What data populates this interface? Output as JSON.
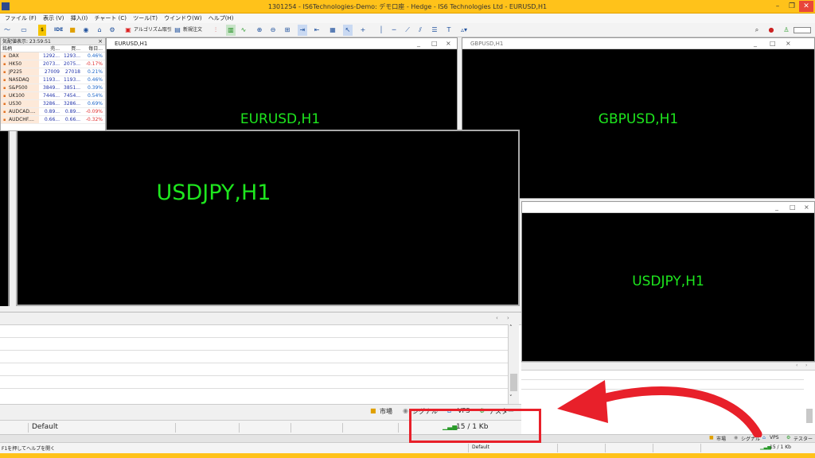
{
  "window": {
    "title": "1301254 - IS6Technologies-Demo: デモ口座 - Hedge - IS6 Technologies Ltd - EURUSD,H1",
    "minimize": "–",
    "maximize": "❐",
    "close": "✕"
  },
  "menu": [
    "ファイル (F)",
    "表示 (V)",
    "挿入(I)",
    "チャート (C)",
    "ツール(T)",
    "ウインドウ(W)",
    "ヘルプ(H)"
  ],
  "toolbar": {
    "algo_label": "アルゴリズム取引",
    "new_order_label": "新規注文",
    "ide_label": "IDE"
  },
  "market_watch": {
    "header": "気配値表示: 23:59:51",
    "columns": [
      "銘柄",
      "売...",
      "買...",
      "毎日..."
    ],
    "rows": [
      {
        "symbol": "DAX",
        "bid": "1292...",
        "ask": "1293...",
        "change": "0.46%"
      },
      {
        "symbol": "HK50",
        "bid": "2073...",
        "ask": "2075...",
        "change": "-0.17%"
      },
      {
        "symbol": "JP225",
        "bid": "27009",
        "ask": "27018",
        "change": "0.21%"
      },
      {
        "symbol": "NASDAQ",
        "bid": "1193...",
        "ask": "1193...",
        "change": "0.46%"
      },
      {
        "symbol": "S&P500",
        "bid": "3849...",
        "ask": "3851...",
        "change": "0.39%"
      },
      {
        "symbol": "UK100",
        "bid": "7446...",
        "ask": "7454...",
        "change": "0.54%"
      },
      {
        "symbol": "US30",
        "bid": "3286...",
        "ask": "3286...",
        "change": "0.69%"
      },
      {
        "symbol": "AUDCAD....",
        "bid": "0.89...",
        "ask": "0.89...",
        "change": "-0.09%"
      },
      {
        "symbol": "AUDCHF....",
        "bid": "0.66...",
        "ask": "0.66...",
        "change": "-0.32%"
      }
    ]
  },
  "charts": {
    "eurusd_caption": "EURUSD,H1",
    "eurusd_label": "EURUSD,H1",
    "gbpusd_caption": "GBPUSD,H1",
    "gbpusd_label": "GBPUSD,H1",
    "usdjpy_label": "USDJPY,H1",
    "usdjpy_small_label": "USDJPY,H1"
  },
  "status_inner": {
    "profile": "Default",
    "connection": "15 / 1 Kb"
  },
  "inner_tabs": {
    "market": "市場",
    "signal": "シグナル",
    "vps": "VPS",
    "tester": "テスター"
  },
  "bottom_tabs": {
    "market": "市場",
    "signal": "シグナル",
    "vps": "VPS",
    "tester": "テスター"
  },
  "status_bottom": {
    "help": "F1を押してヘルプを開く",
    "profile": "Default",
    "connection": "15 / 1 Kb"
  },
  "colors": {
    "title_bar": "#ffc21a",
    "chart_label": "#1ee61e",
    "annotation": "#e8202a"
  }
}
